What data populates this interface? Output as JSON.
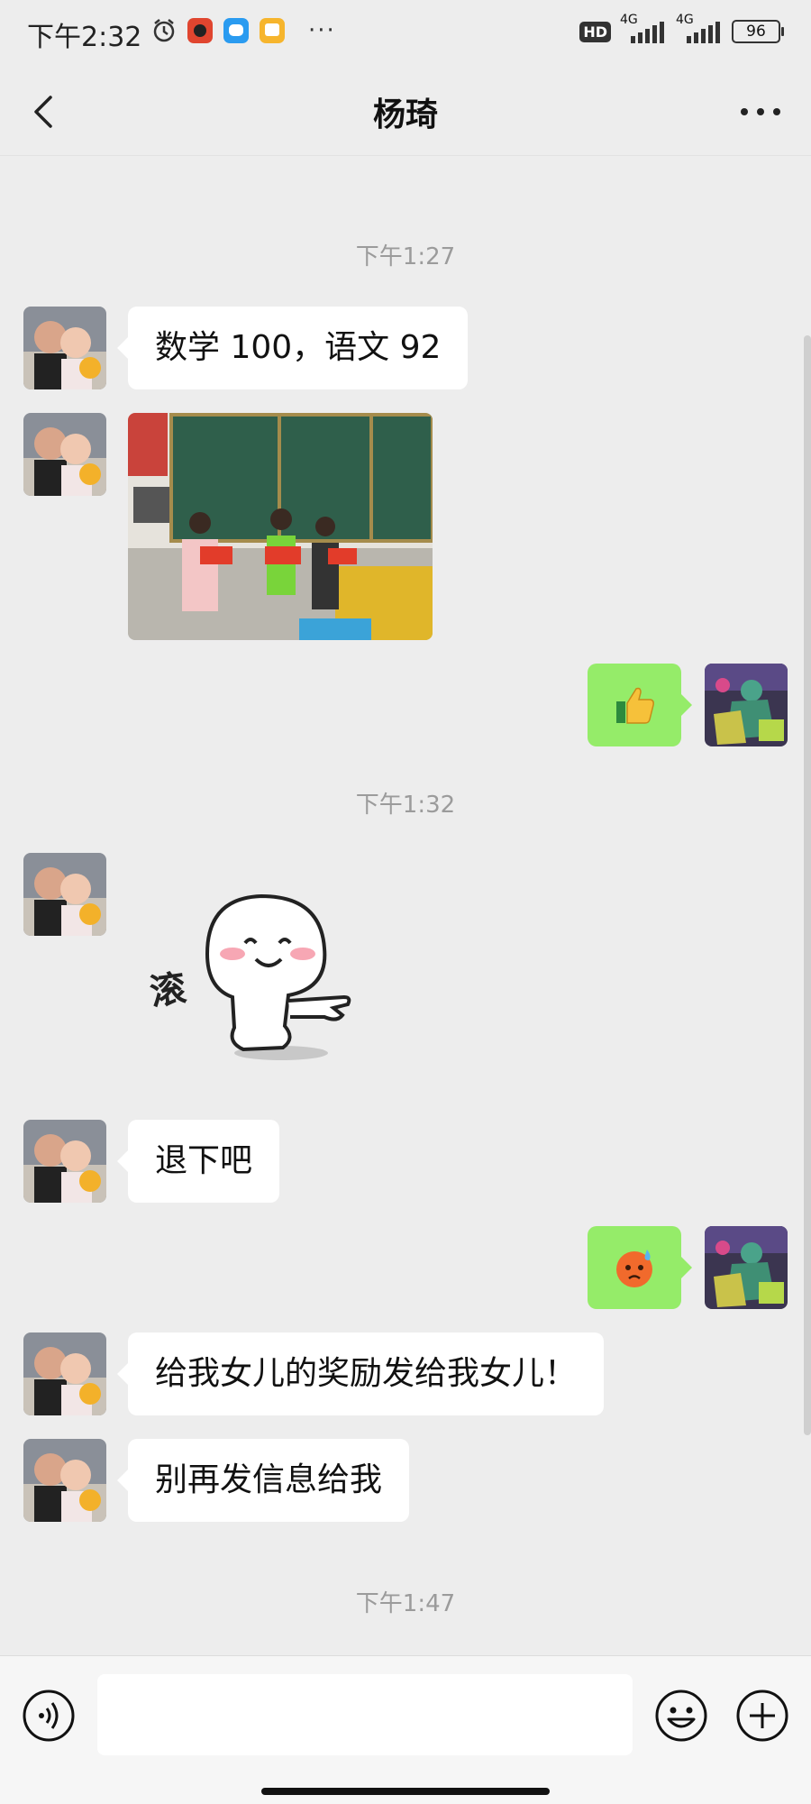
{
  "status_bar": {
    "time": "下午2:32",
    "network_1": "4G",
    "network_2": "4G",
    "battery": "96",
    "hd_label": "HD"
  },
  "header": {
    "title": "杨琦"
  },
  "messages": [
    {
      "type": "timestamp",
      "text": "下午1:27"
    },
    {
      "type": "text",
      "side": "left",
      "text": "数学 100，语文 92"
    },
    {
      "type": "image",
      "side": "left"
    },
    {
      "type": "emoji",
      "side": "right",
      "icon": "thumbs-up-icon"
    },
    {
      "type": "timestamp",
      "text": "下午1:32"
    },
    {
      "type": "sticker",
      "side": "left",
      "caption": "滚"
    },
    {
      "type": "text",
      "side": "left",
      "text": "退下吧"
    },
    {
      "type": "emoji",
      "side": "right",
      "icon": "sweat-face-icon"
    },
    {
      "type": "text",
      "side": "left",
      "text": "给我女儿的奖励发给我女儿！"
    },
    {
      "type": "text",
      "side": "left",
      "text": "别再发信息给我"
    },
    {
      "type": "timestamp",
      "text": "下午1:47"
    }
  ],
  "input": {
    "value": "",
    "placeholder": ""
  },
  "colors": {
    "background": "#ededed",
    "sent_bubble": "#95ec69",
    "received_bubble": "#ffffff"
  }
}
